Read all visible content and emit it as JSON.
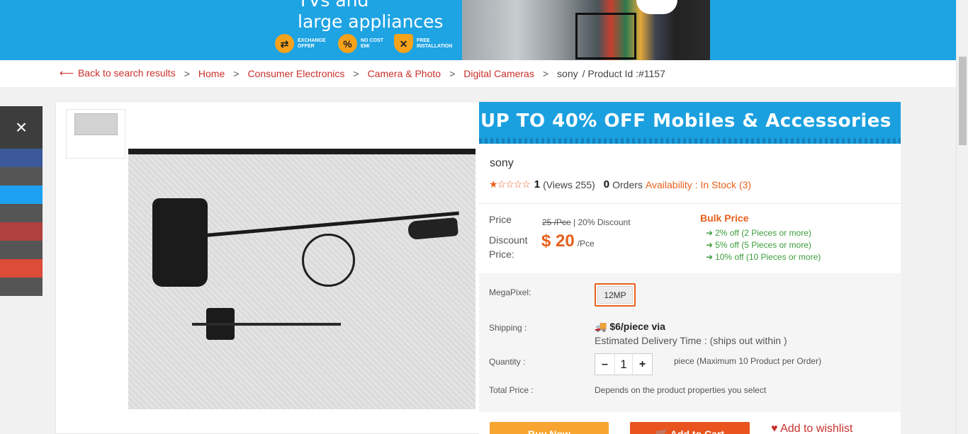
{
  "banner": {
    "headline_line1": "TVs and",
    "headline_line2": "large appliances",
    "features": [
      {
        "icon": "exchange-icon",
        "line1": "EXCHANGE",
        "line2": "OFFER"
      },
      {
        "icon": "percent-icon",
        "line1": "NO COST",
        "line2": "EMI"
      },
      {
        "icon": "tools-icon",
        "line1": "FREE",
        "line2": "INSTALLATION"
      }
    ],
    "color": "#1ea3e3"
  },
  "breadcrumb": {
    "back": "Back to search results",
    "items": [
      "Home",
      "Consumer Electronics",
      "Camera & Photo",
      "Digital Cameras"
    ],
    "current": "sony",
    "product_id": "/ Product Id :#1157"
  },
  "social": {
    "close": "×",
    "colors": [
      "#3b5998",
      "#555555",
      "#1da1f2",
      "#555555",
      "#b0413e",
      "#555555",
      "#dd4b39",
      "#555555"
    ]
  },
  "promo": {
    "text": "UP TO 40% OFF  Mobiles & Accessories"
  },
  "product": {
    "title": "sony",
    "rating_stars": "★☆☆☆☆",
    "rating": "1",
    "views": "(Views 255)",
    "orders_count": "0",
    "orders_label": "Orders",
    "availability": "Availability : In Stock (3)",
    "price_label": "Price",
    "old_price": "25 /Pce",
    "discount": "| 20% Discount",
    "discount_label": "Discount Price:",
    "discount_price": "$ 20",
    "discount_unit": "/Pce",
    "bulk_title": "Bulk Price",
    "bulk": [
      "2% off (2 Pieces or more)",
      "5% off (5 Pieces or more)",
      "10% off (10 Pieces or more)"
    ]
  },
  "specs": {
    "megapixel_label": "MegaPixel:",
    "megapixel_value": "12MP",
    "shipping_label": "Shipping :",
    "shipping_value": "$6/piece via",
    "delivery": "Estimated Delivery Time : (ships out within )",
    "quantity_label": "Quantity :",
    "qty_minus": "–",
    "qty_value": "1",
    "qty_plus": "+",
    "qty_note": "piece (Maximum 10 Product per Order)",
    "total_label": "Total Price :",
    "total_note": "Depends on the product properties you select"
  },
  "actions": {
    "buy_now": "Buy Now",
    "add_cart": "Add to Cart",
    "wishlist": "Add to wishlist"
  },
  "colors": {
    "accent": "#e8601c",
    "link": "#c9302c",
    "bulk_green": "#3c9d3c"
  }
}
